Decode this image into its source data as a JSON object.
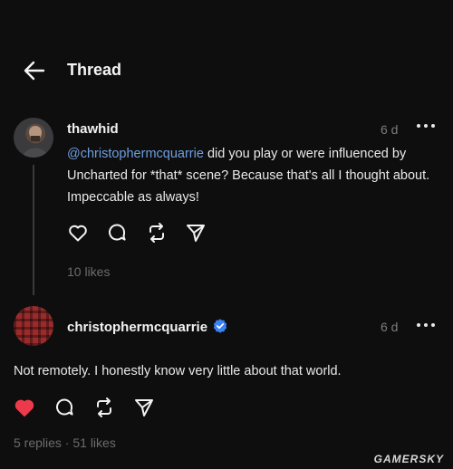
{
  "header": {
    "title": "Thread",
    "back_icon": "arrow-left-icon"
  },
  "post": {
    "username": "thawhid",
    "time": "6 d",
    "mention": "@christophermcquarrie",
    "text": " did you play or were influenced by Uncharted for *that* scene? Because that's all I thought about. Impeccable as always!",
    "likes": "10 likes",
    "actions": [
      "heart-icon",
      "comment-icon",
      "repost-icon",
      "share-icon"
    ]
  },
  "reply": {
    "username": "christophermcquarrie",
    "verified": true,
    "time": "6 d",
    "text": "Not remotely. I honestly know very little about that world.",
    "meta": "5 replies · 51 likes",
    "liked": true,
    "like_color": "#ed3a4b",
    "actions": [
      "heart-filled-icon",
      "comment-icon",
      "repost-icon",
      "share-icon"
    ]
  },
  "watermark": "GAMERSKY",
  "colors": {
    "background": "#0e0e0e",
    "mention": "#6f9fe0",
    "verified": "#3b82f6"
  }
}
